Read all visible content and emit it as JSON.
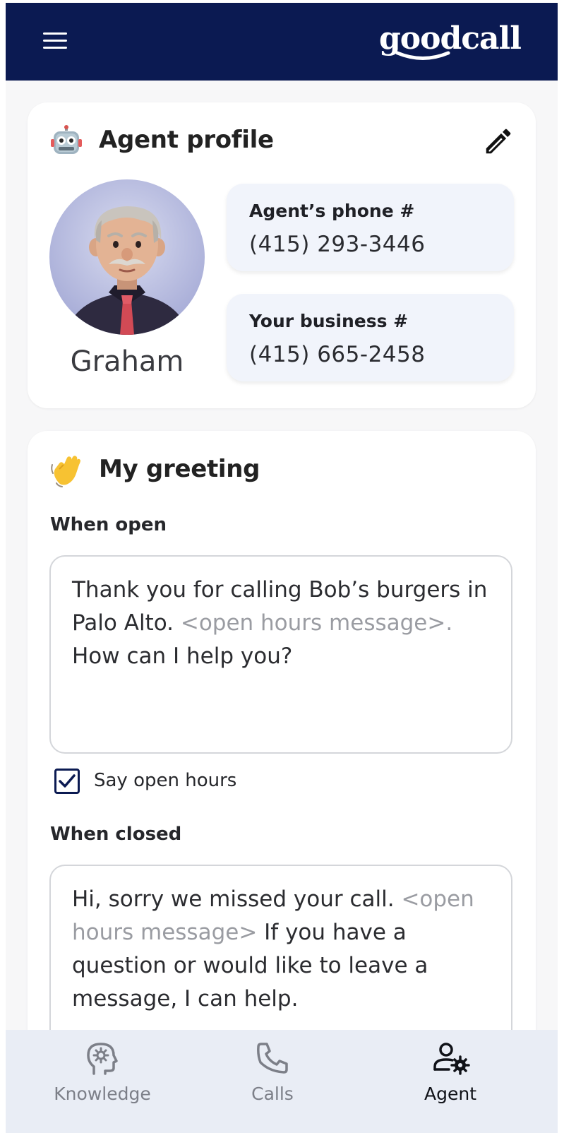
{
  "header": {
    "logo_text": "goodcall",
    "colors": {
      "background": "#0b1a52",
      "foreground": "#ffffff"
    }
  },
  "profile_card": {
    "emoji_icon": "robot-emoji",
    "title": "Agent profile",
    "edit_icon": "pencil-icon",
    "agent_name": "Graham",
    "agent_phone": {
      "label": "Agent’s phone #",
      "value": "(415) 293-3446"
    },
    "business_phone": {
      "label": "Your business #",
      "value": "(415) 665-2458"
    }
  },
  "greeting_card": {
    "emoji_icon": "waving-hand-emoji",
    "title": "My greeting",
    "when_open": {
      "label": "When open",
      "text_before": "Thank you for calling Bob’s burgers in Palo Alto. ",
      "placeholder_token": "<open hours message>.",
      "text_after": " How can I help you?"
    },
    "say_open_hours": {
      "label": "Say open hours",
      "checked": true
    },
    "when_closed": {
      "label": "When closed",
      "text_before": "Hi, sorry we missed your call. ",
      "placeholder_token": "<open hours message>",
      "text_after": " If you have a question or would like to leave a message, I can help."
    }
  },
  "bottom_nav": {
    "items": [
      {
        "label": "Knowledge",
        "icon": "brain-head-icon",
        "active": false
      },
      {
        "label": "Calls",
        "icon": "phone-icon",
        "active": false
      },
      {
        "label": "Agent",
        "icon": "user-gear-icon",
        "active": true
      }
    ]
  },
  "colors": {
    "accent_navy": "#0b1a52",
    "card_bg": "#ffffff",
    "page_bg": "#f7f7f8",
    "info_box_bg": "#f1f4fb",
    "placeholder_text": "#9a9ca2",
    "nav_bg": "#e9edf5"
  }
}
